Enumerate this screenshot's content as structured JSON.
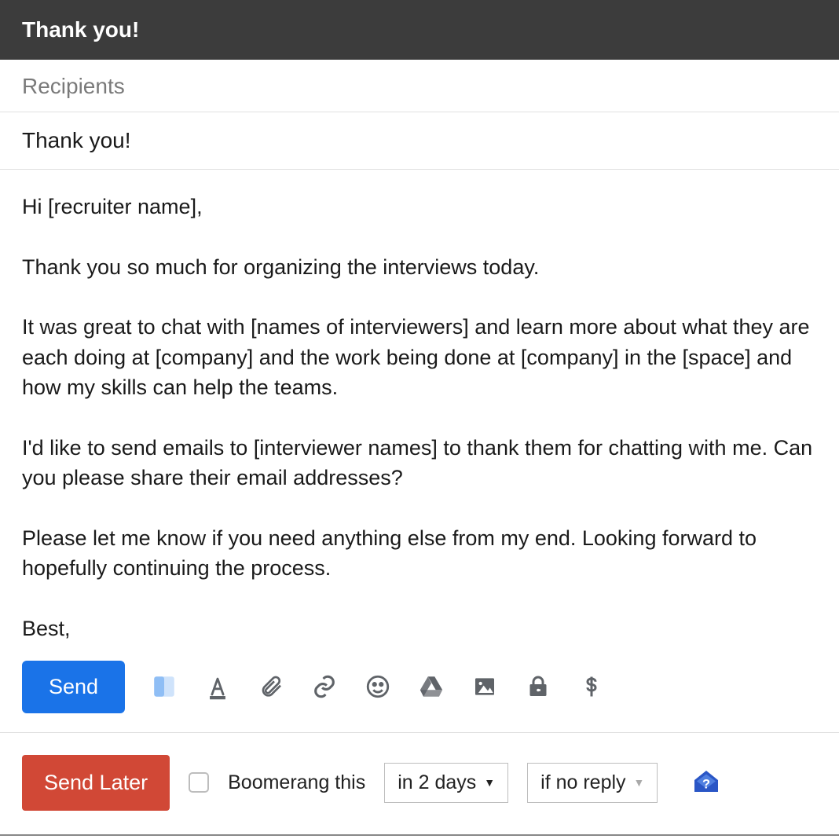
{
  "header": {
    "title": "Thank you!"
  },
  "compose": {
    "recipients_placeholder": "Recipients",
    "subject": "Thank you!",
    "body": "Hi [recruiter name],\n\nThank you so much for organizing the interviews today.\n\nIt was great to chat with [names of interviewers] and learn more about what they are each doing at [company] and the work being done at [company] in the [space] and how my skills can help the teams.\n\nI'd like to send emails to [interviewer names] to thank them for chatting with me. Can you please share their email addresses?\n\nPlease let me know if you need anything else from my end. Looking forward to hopefully continuing the process.\n\nBest,"
  },
  "toolbar": {
    "send_label": "Send",
    "icons": {
      "boomerang_app": "boomerang-app-icon",
      "format": "format-icon",
      "attach": "attach-icon",
      "link": "link-icon",
      "emoji": "emoji-icon",
      "drive": "drive-icon",
      "image": "image-icon",
      "confidential": "confidential-icon",
      "money": "money-icon"
    }
  },
  "boomerang": {
    "send_later_label": "Send Later",
    "checkbox_checked": false,
    "label": "Boomerang this",
    "delay_selected": "in 2 days",
    "condition_selected": "if no reply"
  },
  "colors": {
    "primary_send": "#1a73e8",
    "send_later": "#d14836",
    "header_bg": "#3c3c3c"
  }
}
